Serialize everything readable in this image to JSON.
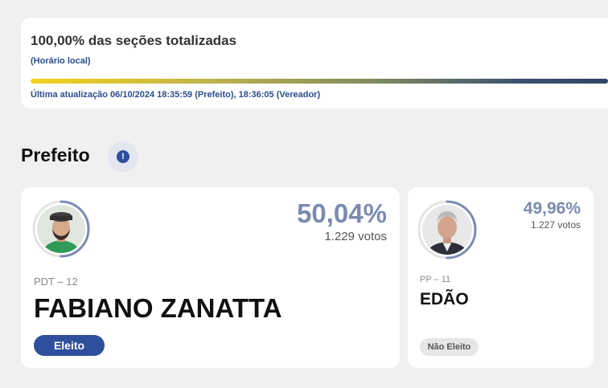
{
  "status": {
    "title": "100,00% das seções totalizadas",
    "local_time": "(Horário local)",
    "progress_percent": 100,
    "last_update": "Última atualização 06/10/2024 18:35:59 (Prefeito), 18:36:05 (Vereador)"
  },
  "section": {
    "title": "Prefeito",
    "info_icon": "info-icon"
  },
  "candidates": [
    {
      "percent": "50,04%",
      "votes": "1.229 votos",
      "party": "PDT – 12",
      "name": "FABIANO ZANATTA",
      "status": "Eleito",
      "vote_share": 50.04
    },
    {
      "percent": "49,96%",
      "votes": "1.227 votos",
      "party": "PP – 11",
      "name": "EDÃO",
      "status": "Não Eleito",
      "vote_share": 49.96
    }
  ],
  "colors": {
    "accent": "#2e4f9c",
    "percent_text": "#7b8bb0",
    "background": "#f0f0f1"
  }
}
